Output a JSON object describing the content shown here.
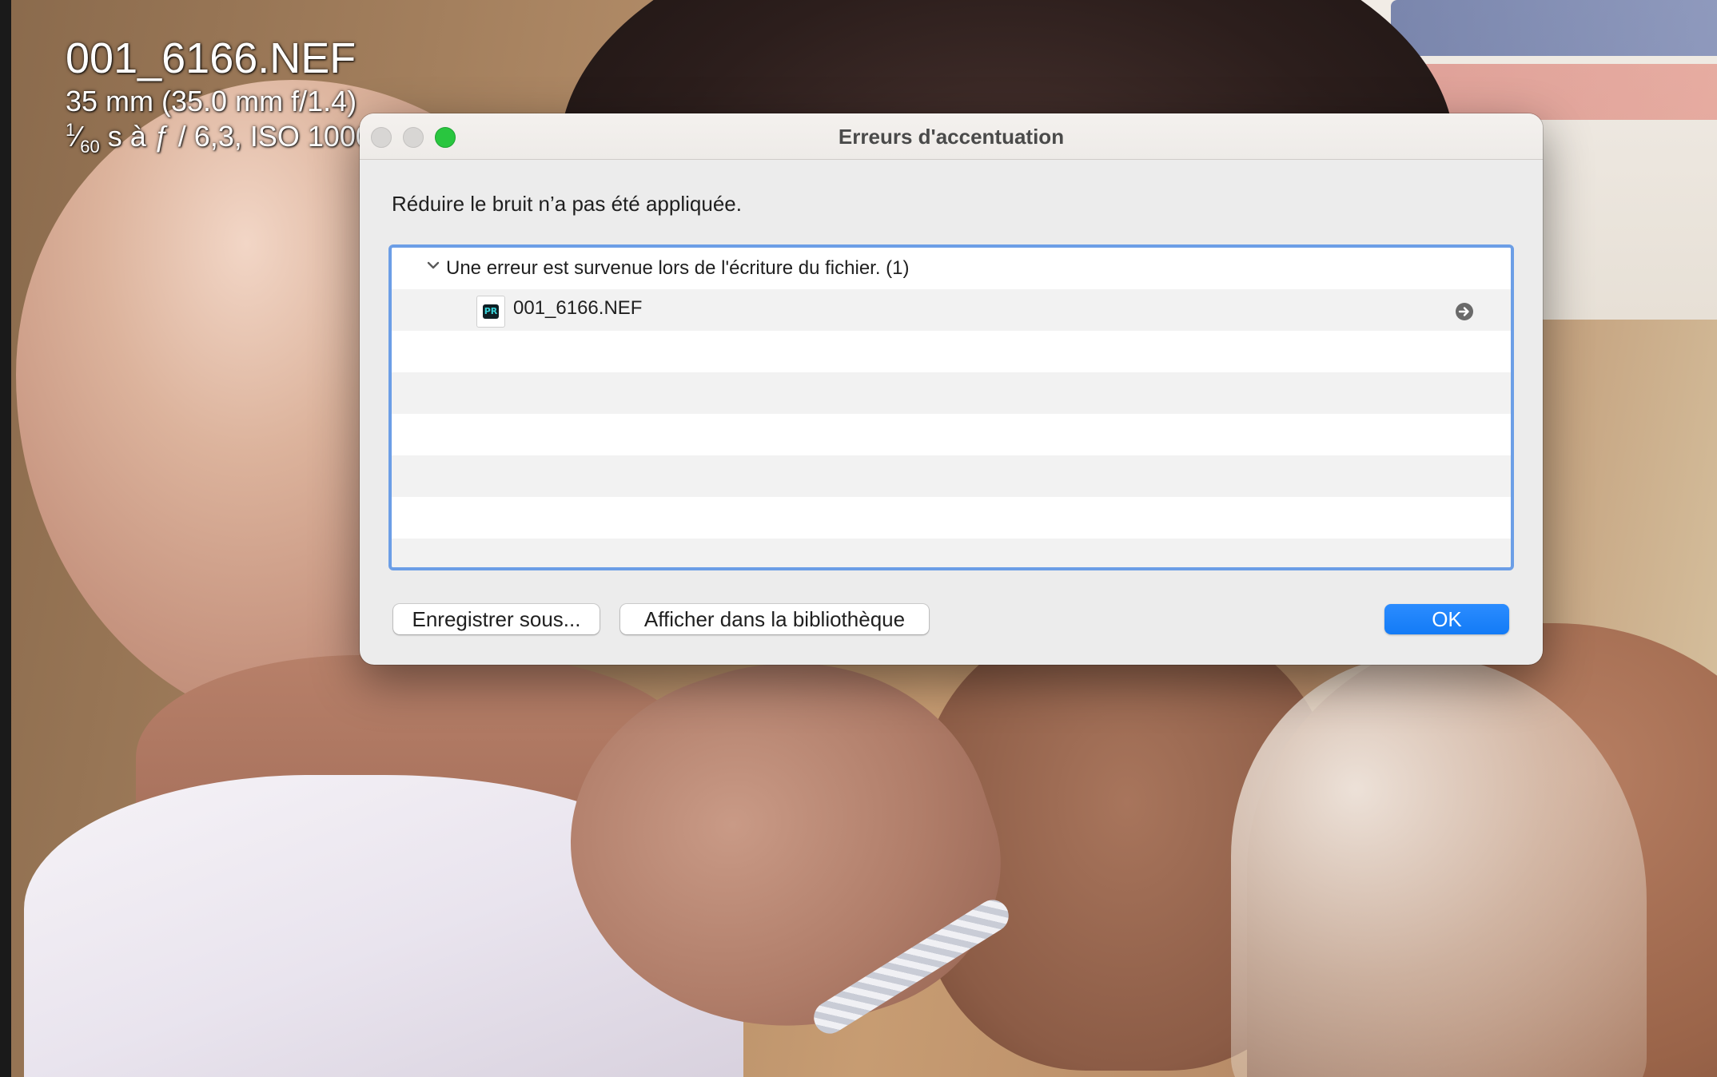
{
  "photo_overlay": {
    "filename": "001_6166.NEF",
    "lens": "35 mm (35.0 mm f/1.4)",
    "shutter_numerator": "1",
    "shutter_denominator": "60",
    "exposure_rest": " s à ƒ / 6,3, ISO 1000"
  },
  "dialog": {
    "title": "Erreurs d'accentuation",
    "message": "Réduire le bruit n’a pas été appliquée.",
    "error_group": {
      "label": "Une erreur est survenue lors de l'écriture du fichier. (1)",
      "expanded": true,
      "files": [
        {
          "name": "001_6166.NEF",
          "icon": "lightroom-raw-file-icon",
          "icon_badge": "PR"
        }
      ]
    },
    "buttons": {
      "save_as": "Enregistrer sous...",
      "show_in_library": "Afficher dans la bibliothèque",
      "ok": "OK"
    },
    "window_controls": {
      "close": "close-icon",
      "minimize": "minimize-icon",
      "zoom": "zoom-icon"
    }
  },
  "colors": {
    "accent": "#137bf6",
    "list_focus_border": "#6c9ee6",
    "zoom_button": "#29c63f"
  }
}
